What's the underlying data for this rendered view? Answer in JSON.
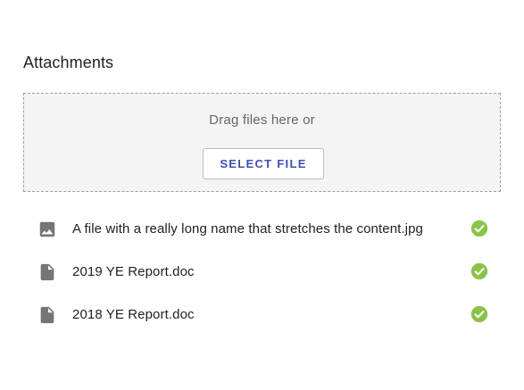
{
  "attachments": {
    "title": "Attachments",
    "dropzone": {
      "hint": "Drag files here or",
      "button_label": "SELECT FILE"
    },
    "files": [
      {
        "name": "A file with a really long name that stretches the content.jpg",
        "type_icon": "image-icon",
        "status_icon": "check-circle-icon"
      },
      {
        "name": "2019 YE Report.doc",
        "type_icon": "document-icon",
        "status_icon": "check-circle-icon"
      },
      {
        "name": "2018 YE Report.doc",
        "type_icon": "document-icon",
        "status_icon": "check-circle-icon"
      }
    ]
  },
  "colors": {
    "accent": "#3f51b5",
    "success": "#8bc34a",
    "dropzone_bg": "#f4f4f4",
    "icon_gray": "#757575"
  }
}
